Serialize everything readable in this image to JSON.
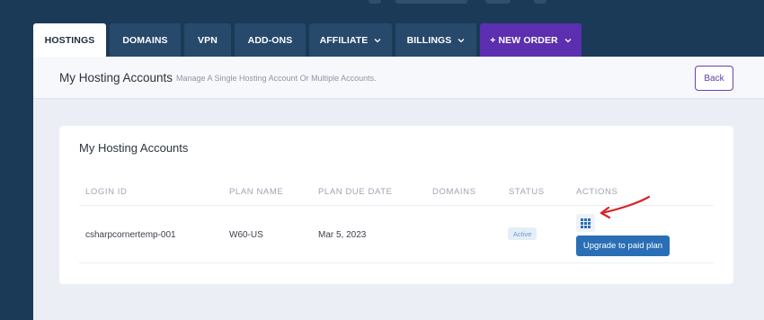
{
  "tabs": [
    {
      "label": "HOSTINGS",
      "active": true,
      "dropdown": false
    },
    {
      "label": "DOMAINS",
      "active": false,
      "dropdown": false
    },
    {
      "label": "VPN",
      "active": false,
      "dropdown": false
    },
    {
      "label": "ADD-ONS",
      "active": false,
      "dropdown": false
    },
    {
      "label": "AFFILIATE",
      "active": false,
      "dropdown": true
    },
    {
      "label": "BILLINGS",
      "active": false,
      "dropdown": true
    },
    {
      "label": "+ NEW ORDER",
      "active": false,
      "dropdown": true
    }
  ],
  "header": {
    "title": "My Hosting Accounts",
    "subtitle": "Manage A Single Hosting Account Or Multiple Accounts.",
    "back_label": "Back"
  },
  "card": {
    "title": "My Hosting Accounts",
    "columns": [
      "LOGIN ID",
      "PLAN NAME",
      "PLAN DUE DATE",
      "DOMAINS",
      "STATUS",
      "ACTIONS"
    ],
    "rows": [
      {
        "login_id": "csharpcornertemp-001",
        "plan_name": "W60-US",
        "due_date": "Mar 5, 2023",
        "domains": "",
        "status": "Active",
        "action_icon": "grid-icon",
        "upgrade_label": "Upgrade to paid plan"
      }
    ]
  },
  "colors": {
    "background": "#1b3a57",
    "tab": "#27496b",
    "new_order_tab": "#5b2fb0",
    "primary_button": "#2a6fb6",
    "annotation_arrow": "#d9232a"
  }
}
